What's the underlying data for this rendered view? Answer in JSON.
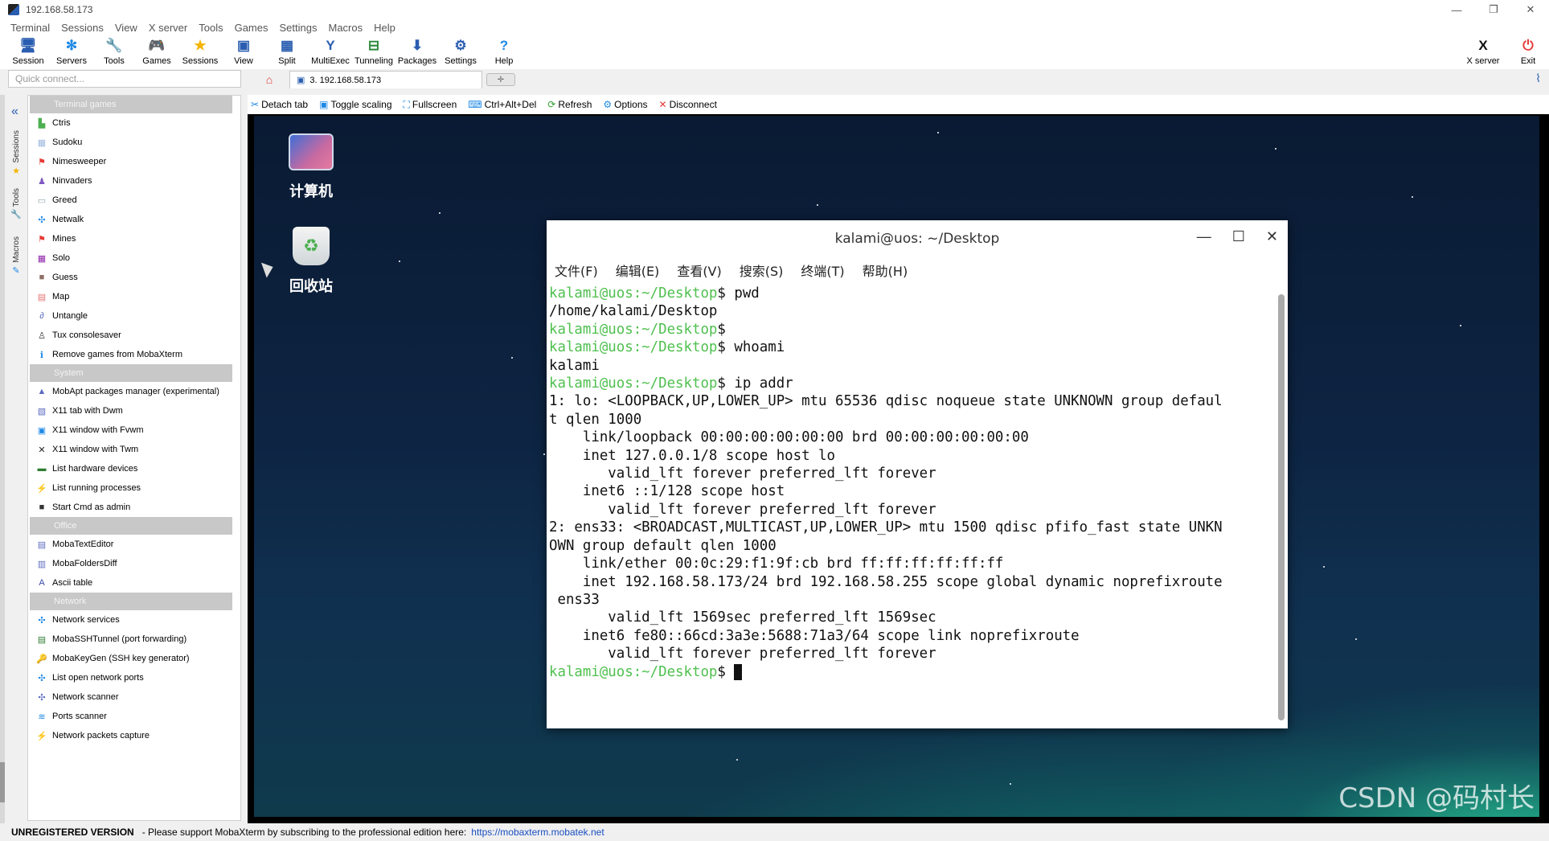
{
  "window": {
    "title": "192.168.58.173",
    "min": "—",
    "restore": "❐",
    "close": "✕"
  },
  "menu": [
    "Terminal",
    "Sessions",
    "View",
    "X server",
    "Tools",
    "Games",
    "Settings",
    "Macros",
    "Help"
  ],
  "toolbar": {
    "items": [
      {
        "label": "Session",
        "icon": "session-icon",
        "glyph": "🖥",
        "color": "#2a5db0"
      },
      {
        "label": "Servers",
        "icon": "servers-icon",
        "glyph": "✻",
        "color": "#1e88e5"
      },
      {
        "label": "Tools",
        "icon": "tools-icon",
        "glyph": "🔧",
        "color": "#d03030"
      },
      {
        "label": "Games",
        "icon": "games-icon",
        "glyph": "🎮",
        "color": "#555"
      },
      {
        "label": "Sessions",
        "icon": "sessions-star-icon",
        "glyph": "★",
        "color": "#f5b400"
      },
      {
        "label": "View",
        "icon": "view-icon",
        "glyph": "▣",
        "color": "#2a5db0"
      },
      {
        "label": "Split",
        "icon": "split-icon",
        "glyph": "▦",
        "color": "#2a5db0"
      },
      {
        "label": "MultiExec",
        "icon": "multiexec-icon",
        "glyph": "Y",
        "color": "#2a5db0"
      },
      {
        "label": "Tunneling",
        "icon": "tunneling-icon",
        "glyph": "⊟",
        "color": "#2a8a3a"
      },
      {
        "label": "Packages",
        "icon": "packages-icon",
        "glyph": "⬇",
        "color": "#2a5db0"
      },
      {
        "label": "Settings",
        "icon": "settings-icon",
        "glyph": "⚙",
        "color": "#2a5db0"
      },
      {
        "label": "Help",
        "icon": "help-icon",
        "glyph": "?",
        "color": "#1e88e5"
      }
    ],
    "xserver": "X server",
    "exit": "Exit"
  },
  "quick_connect": {
    "placeholder": "Quick connect..."
  },
  "tab": {
    "label": "3. 192.168.58.173"
  },
  "sidebar_tabs": [
    "Sessions",
    "Tools",
    "Macros"
  ],
  "panel": {
    "sections": [
      {
        "title": "Terminal games",
        "items": [
          {
            "label": "Ctris",
            "icon": "ctris-icon",
            "glyph": "▙",
            "color": "#4caf50"
          },
          {
            "label": "Sudoku",
            "icon": "sudoku-icon",
            "glyph": "▦",
            "color": "#9db9e0"
          },
          {
            "label": "Nimesweeper",
            "icon": "nimesweeper-icon",
            "glyph": "⚑",
            "color": "#e53935"
          },
          {
            "label": "Ninvaders",
            "icon": "ninvaders-icon",
            "glyph": "♟",
            "color": "#7e57c2"
          },
          {
            "label": "Greed",
            "icon": "greed-icon",
            "glyph": "▭",
            "color": "#90a4ae"
          },
          {
            "label": "Netwalk",
            "icon": "netwalk-icon",
            "glyph": "✣",
            "color": "#1e88e5"
          },
          {
            "label": "Mines",
            "icon": "mines-icon",
            "glyph": "⚑",
            "color": "#e53935"
          },
          {
            "label": "Solo",
            "icon": "solo-icon",
            "glyph": "▦",
            "color": "#8e24aa"
          },
          {
            "label": "Guess",
            "icon": "guess-icon",
            "glyph": "■",
            "color": "#8d6e63"
          },
          {
            "label": "Map",
            "icon": "map-icon",
            "glyph": "▤",
            "color": "#e57373"
          },
          {
            "label": "Untangle",
            "icon": "untangle-icon",
            "glyph": "∂",
            "color": "#5c6bc0"
          },
          {
            "label": "Tux consolesaver",
            "icon": "tux-icon",
            "glyph": "♙",
            "color": "#333"
          },
          {
            "label": "Remove games from MobaXterm",
            "icon": "info-icon",
            "glyph": "ℹ",
            "color": "#1e88e5"
          }
        ]
      },
      {
        "title": "System",
        "items": [
          {
            "label": "MobApt packages manager (experimental)",
            "icon": "mobapt-icon",
            "glyph": "▲",
            "color": "#5c6bc0"
          },
          {
            "label": "X11 tab with Dwm",
            "icon": "x11-dwm-icon",
            "glyph": "▧",
            "color": "#5c6bc0"
          },
          {
            "label": "X11 window with Fvwm",
            "icon": "x11-fvwm-icon",
            "glyph": "▣",
            "color": "#1e88e5"
          },
          {
            "label": "X11 window with Twm",
            "icon": "x11-twm-icon",
            "glyph": "✕",
            "color": "#222"
          },
          {
            "label": "List hardware devices",
            "icon": "hardware-icon",
            "glyph": "▬",
            "color": "#2e7d32"
          },
          {
            "label": "List running processes",
            "icon": "processes-icon",
            "glyph": "⚡",
            "color": "#1e88e5"
          },
          {
            "label": "Start Cmd as admin",
            "icon": "cmd-icon",
            "glyph": "■",
            "color": "#333"
          }
        ]
      },
      {
        "title": "Office",
        "items": [
          {
            "label": "MobaTextEditor",
            "icon": "texteditor-icon",
            "glyph": "▤",
            "color": "#5c6bc0"
          },
          {
            "label": "MobaFoldersDiff",
            "icon": "foldersdiff-icon",
            "glyph": "▥",
            "color": "#5c6bc0"
          },
          {
            "label": "Ascii table",
            "icon": "ascii-icon",
            "glyph": "A",
            "color": "#3949ab"
          }
        ]
      },
      {
        "title": "Network",
        "items": [
          {
            "label": "Network services",
            "icon": "network-services-icon",
            "glyph": "✣",
            "color": "#1e88e5"
          },
          {
            "label": "MobaSSHTunnel (port forwarding)",
            "icon": "sshtunnel-icon",
            "glyph": "▤",
            "color": "#2e7d32"
          },
          {
            "label": "MobaKeyGen (SSH key generator)",
            "icon": "keygen-icon",
            "glyph": "🔑",
            "color": "#f5a000"
          },
          {
            "label": "List open network ports",
            "icon": "ports-list-icon",
            "glyph": "✣",
            "color": "#1e88e5"
          },
          {
            "label": "Network scanner",
            "icon": "network-scanner-icon",
            "glyph": "✣",
            "color": "#5c6bc0"
          },
          {
            "label": "Ports scanner",
            "icon": "ports-scanner-icon",
            "glyph": "≋",
            "color": "#1e88e5"
          },
          {
            "label": "Network packets capture",
            "icon": "packets-capture-icon",
            "glyph": "⚡",
            "color": "#8e24aa"
          }
        ]
      }
    ]
  },
  "actions": [
    {
      "label": "Detach tab",
      "icon": "detach-icon",
      "glyph": "✂",
      "color": "#1e88e5"
    },
    {
      "label": "Toggle scaling",
      "icon": "scaling-icon",
      "glyph": "▣",
      "color": "#1e88e5"
    },
    {
      "label": "Fullscreen",
      "icon": "fullscreen-icon",
      "glyph": "⛶",
      "color": "#1e88e5"
    },
    {
      "label": "Ctrl+Alt+Del",
      "icon": "ctrl-alt-del-icon",
      "glyph": "⌨",
      "color": "#1e88e5"
    },
    {
      "label": "Refresh",
      "icon": "refresh-icon",
      "glyph": "⟳",
      "color": "#2e9e2e"
    },
    {
      "label": "Options",
      "icon": "options-icon",
      "glyph": "⚙",
      "color": "#1e88e5"
    },
    {
      "label": "Disconnect",
      "icon": "disconnect-icon",
      "glyph": "✕",
      "color": "#e53935"
    }
  ],
  "desktop": {
    "icons": [
      {
        "label": "计算机",
        "icon": "computer-icon"
      },
      {
        "label": "回收站",
        "icon": "trash-icon"
      }
    ]
  },
  "terminal": {
    "title": "kalami@uos: ~/Desktop",
    "menu": [
      "文件(F)",
      "编辑(E)",
      "查看(V)",
      "搜索(S)",
      "终端(T)",
      "帮助(H)"
    ],
    "prompt_user": "kalami@uos",
    "prompt_path": ":~/Desktop",
    "prompt_sign": "$ ",
    "lines": [
      {
        "prompt": true,
        "text": "pwd"
      },
      {
        "prompt": false,
        "text": "/home/kalami/Desktop"
      },
      {
        "prompt": true,
        "text": ""
      },
      {
        "prompt": true,
        "text": "whoami"
      },
      {
        "prompt": false,
        "text": "kalami"
      },
      {
        "prompt": true,
        "text": "ip addr"
      },
      {
        "prompt": false,
        "text": "1: lo: <LOOPBACK,UP,LOWER_UP> mtu 65536 qdisc noqueue state UNKNOWN group defaul"
      },
      {
        "prompt": false,
        "text": "t qlen 1000"
      },
      {
        "prompt": false,
        "text": "    link/loopback 00:00:00:00:00:00 brd 00:00:00:00:00:00"
      },
      {
        "prompt": false,
        "text": "    inet 127.0.0.1/8 scope host lo"
      },
      {
        "prompt": false,
        "text": "       valid_lft forever preferred_lft forever"
      },
      {
        "prompt": false,
        "text": "    inet6 ::1/128 scope host"
      },
      {
        "prompt": false,
        "text": "       valid_lft forever preferred_lft forever"
      },
      {
        "prompt": false,
        "text": "2: ens33: <BROADCAST,MULTICAST,UP,LOWER_UP> mtu 1500 qdisc pfifo_fast state UNKN"
      },
      {
        "prompt": false,
        "text": "OWN group default qlen 1000"
      },
      {
        "prompt": false,
        "text": "    link/ether 00:0c:29:f1:9f:cb brd ff:ff:ff:ff:ff:ff"
      },
      {
        "prompt": false,
        "text": "    inet 192.168.58.173/24 brd 192.168.58.255 scope global dynamic noprefixroute"
      },
      {
        "prompt": false,
        "text": " ens33"
      },
      {
        "prompt": false,
        "text": "       valid_lft 1569sec preferred_lft 1569sec"
      },
      {
        "prompt": false,
        "text": "    inet6 fe80::66cd:3a3e:5688:71a3/64 scope link noprefixroute"
      },
      {
        "prompt": false,
        "text": "       valid_lft forever preferred_lft forever"
      },
      {
        "prompt": true,
        "text": "",
        "cursor": true
      }
    ]
  },
  "status": {
    "unregistered": "UNREGISTERED VERSION",
    "message": "-  Please support MobaXterm by subscribing to the professional edition here:",
    "link": "https://mobaxterm.mobatek.net"
  },
  "watermark": "CSDN @码村长"
}
